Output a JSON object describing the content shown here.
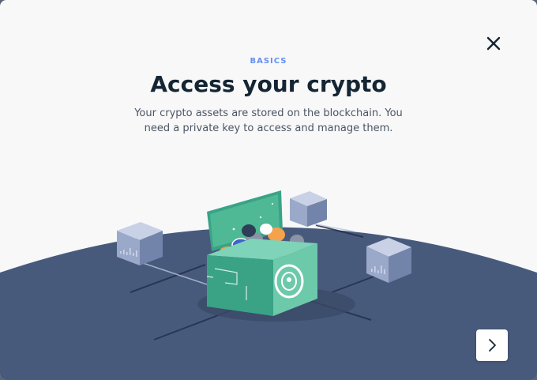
{
  "modal": {
    "eyebrow": "BASICS",
    "title": "Access your crypto",
    "subtitle": "Your crypto assets are stored on the blockchain. You need a private key to access and manage them."
  },
  "icons": {
    "close": "close-icon",
    "next": "chevron-right-icon"
  },
  "colors": {
    "eyebrow": "#6490f1",
    "title": "#142533",
    "ground": "#485a7c",
    "chest": "#3aa386",
    "chest_light": "#7fd3b8"
  }
}
